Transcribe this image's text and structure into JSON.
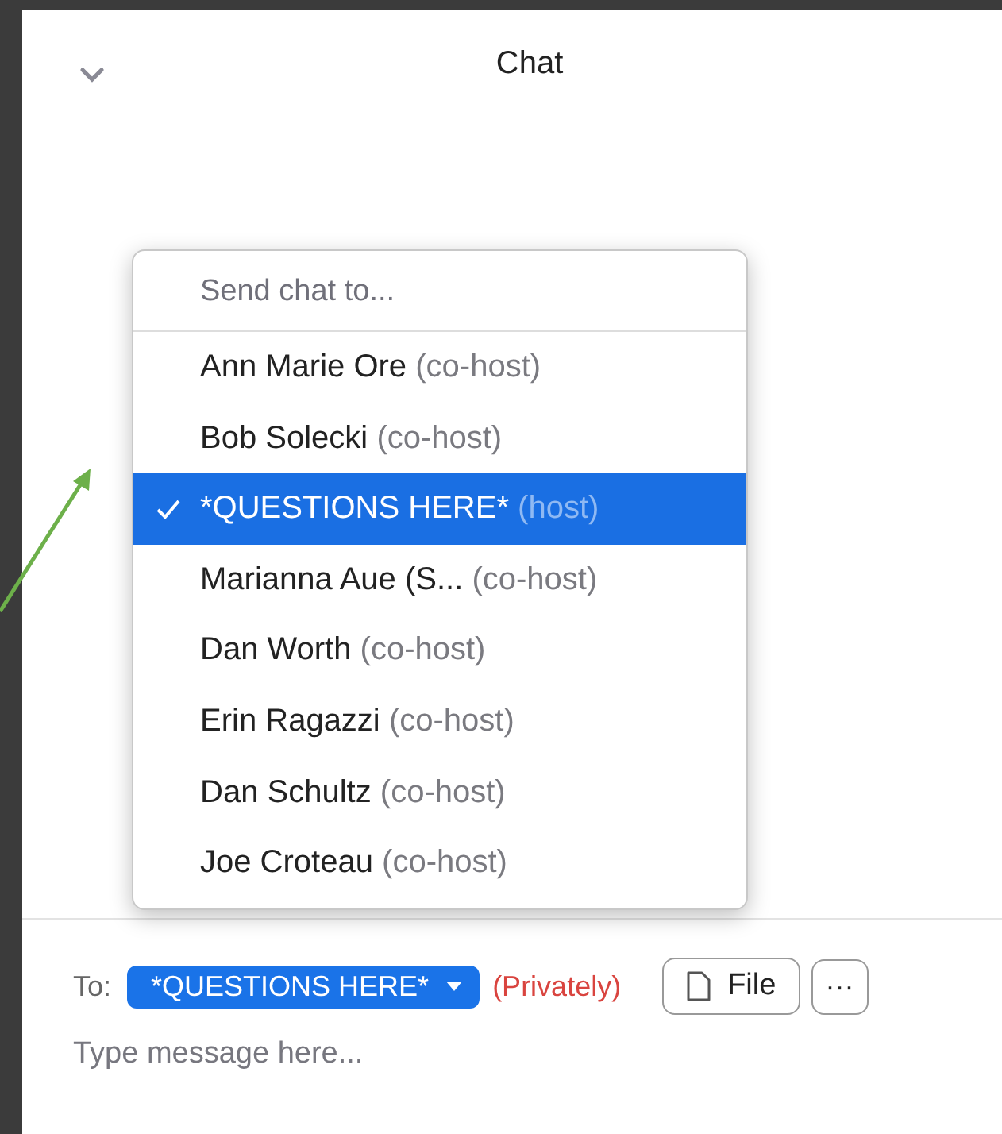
{
  "header": {
    "title": "Chat"
  },
  "menu": {
    "heading": "Send chat to...",
    "recipients": [
      {
        "name": "Ann Marie Ore",
        "role": "(co-host)",
        "selected": false
      },
      {
        "name": "Bob Solecki",
        "role": "(co-host)",
        "selected": false
      },
      {
        "name": "*QUESTIONS HERE*",
        "role": "(host)",
        "selected": true
      },
      {
        "name": "Marianna Aue (S...",
        "role": "(co-host)",
        "selected": false
      },
      {
        "name": "Dan Worth",
        "role": "(co-host)",
        "selected": false
      },
      {
        "name": "Erin Ragazzi",
        "role": "(co-host)",
        "selected": false
      },
      {
        "name": "Dan Schultz",
        "role": "(co-host)",
        "selected": false
      },
      {
        "name": "Joe Croteau",
        "role": "(co-host)",
        "selected": false
      }
    ]
  },
  "compose": {
    "to_label": "To:",
    "recipient": "*QUESTIONS HERE*",
    "privacy": "(Privately)",
    "file_button": "File",
    "more_button": "···",
    "placeholder": "Type message here..."
  }
}
